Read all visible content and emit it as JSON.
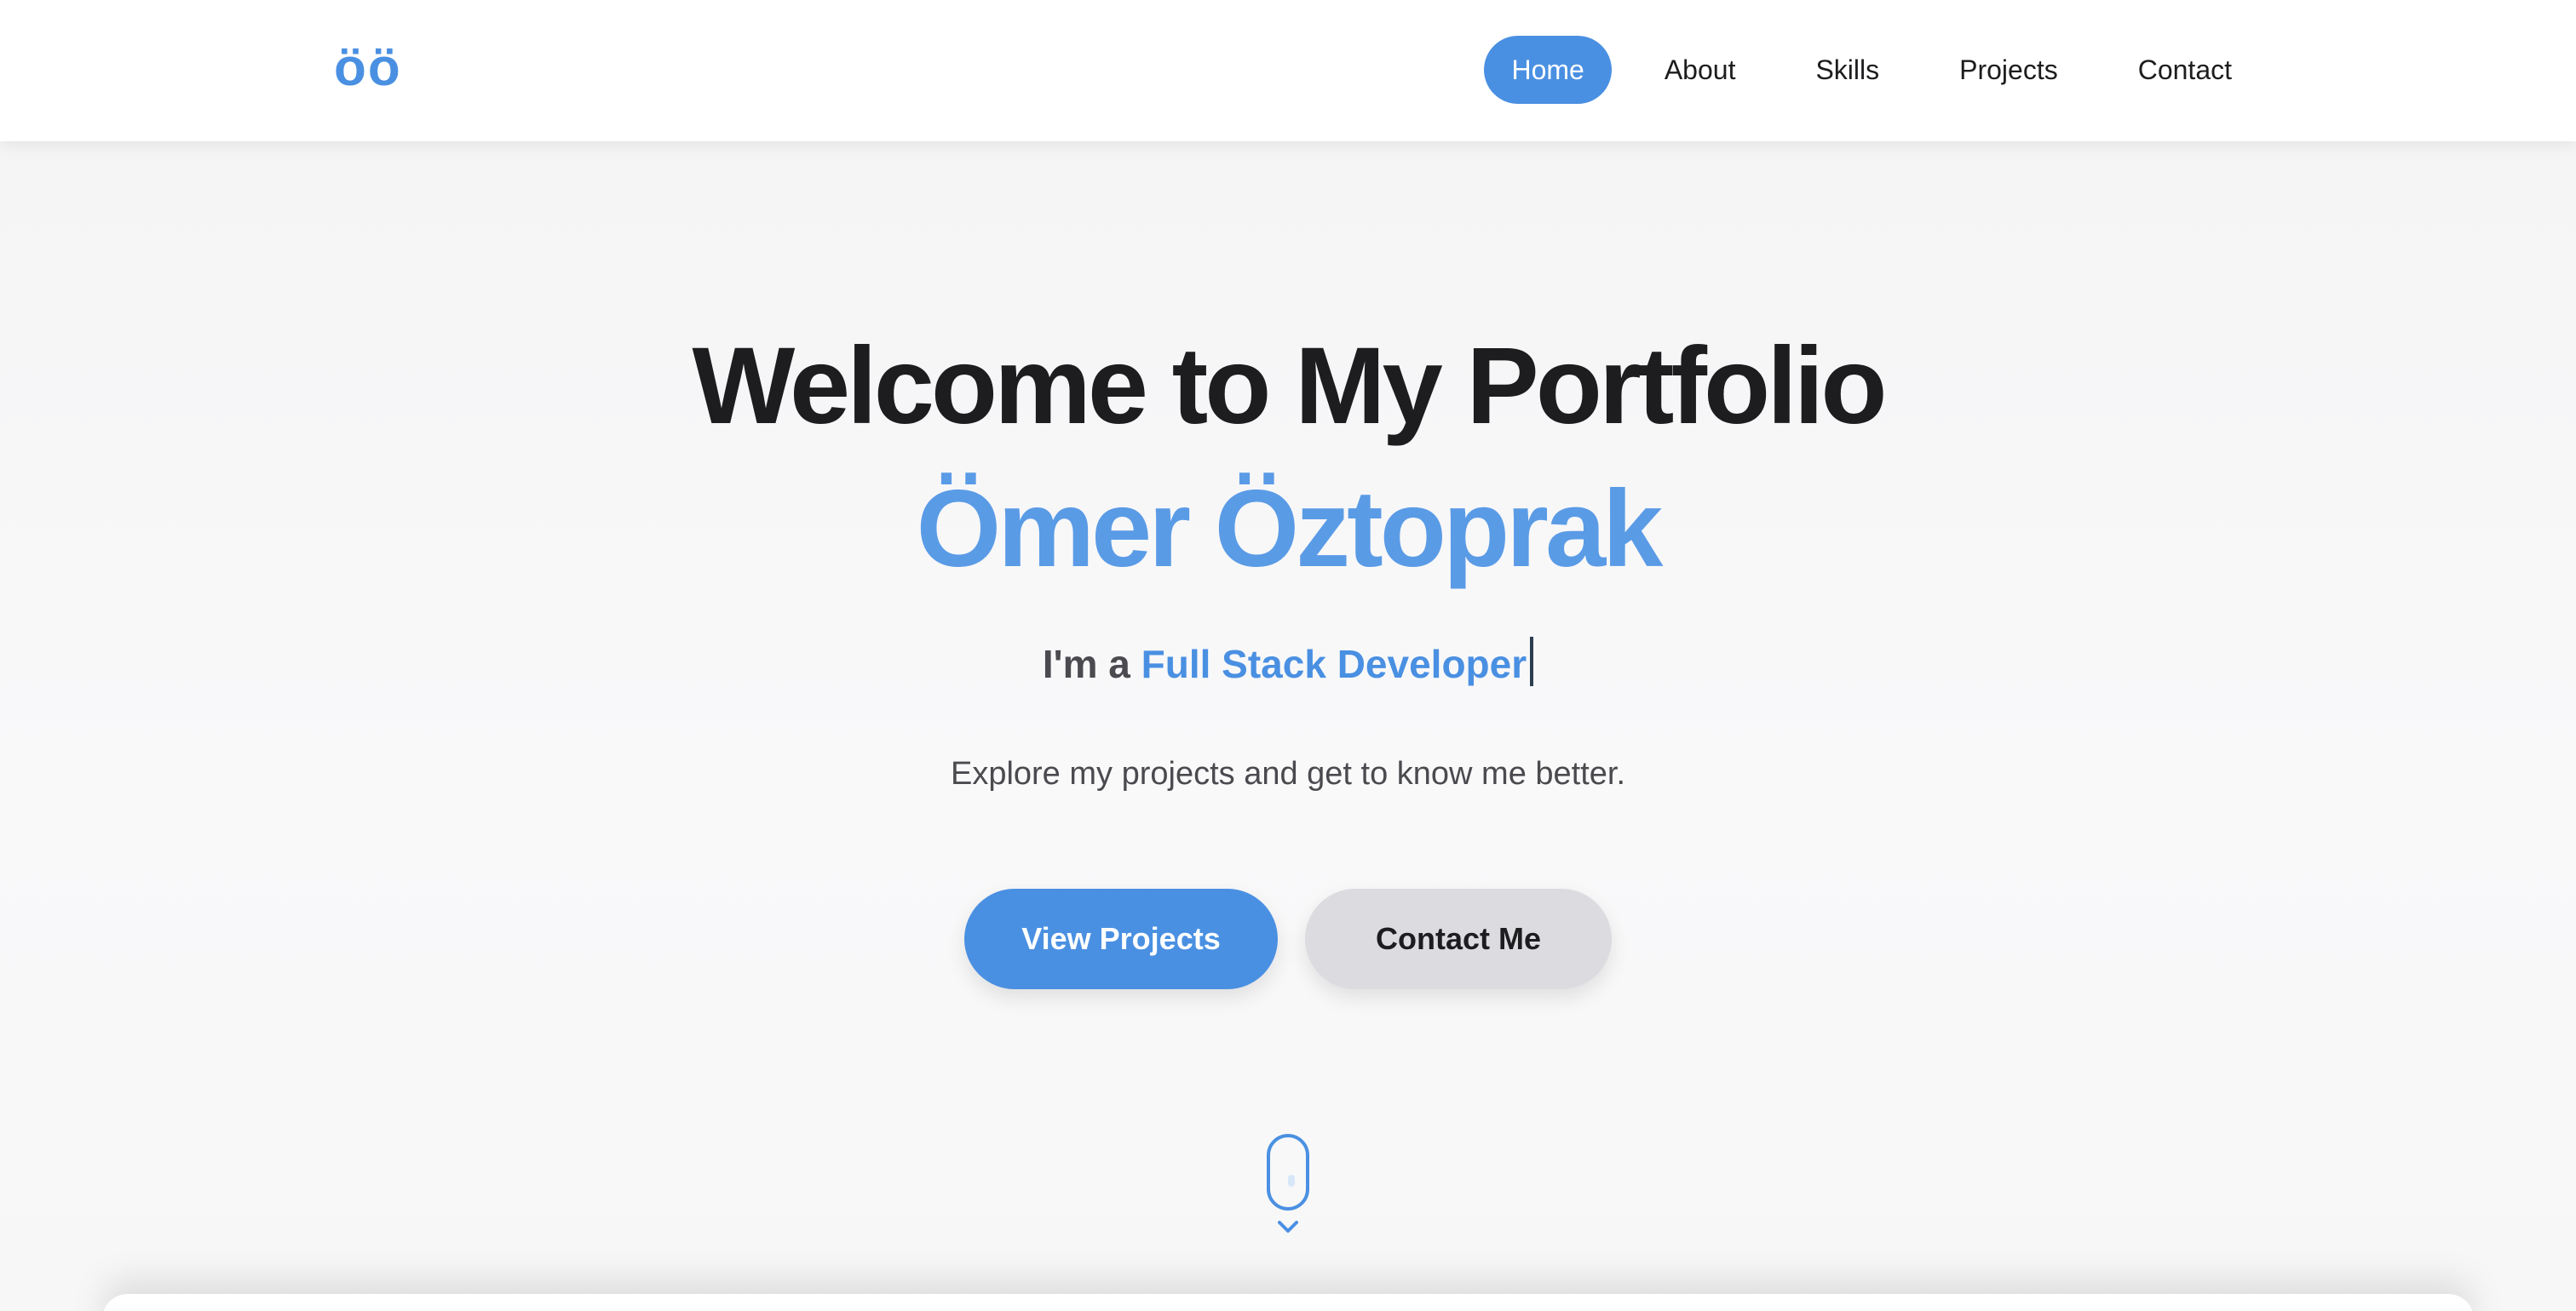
{
  "nav": {
    "logo": "öö",
    "links": [
      {
        "label": "Home",
        "active": true
      },
      {
        "label": "About",
        "active": false
      },
      {
        "label": "Skills",
        "active": false
      },
      {
        "label": "Projects",
        "active": false
      },
      {
        "label": "Contact",
        "active": false
      }
    ]
  },
  "hero": {
    "title": "Welcome to My Portfolio",
    "name": "Ömer Öztoprak",
    "role_prefix": "I'm a ",
    "role": "Full Stack Developer",
    "description": "Explore my projects and get to know me better.",
    "primary_button": "View Projects",
    "secondary_button": "Contact Me"
  },
  "colors": {
    "accent": "#4a90e2",
    "name": "#5a9be6",
    "secondary_button_bg": "#dcdce0",
    "heading": "#1d1d1f",
    "body_text": "#4a4a4f"
  },
  "icons": {
    "scroll": "mouse-scroll-icon",
    "chevron": "chevron-down-icon"
  }
}
